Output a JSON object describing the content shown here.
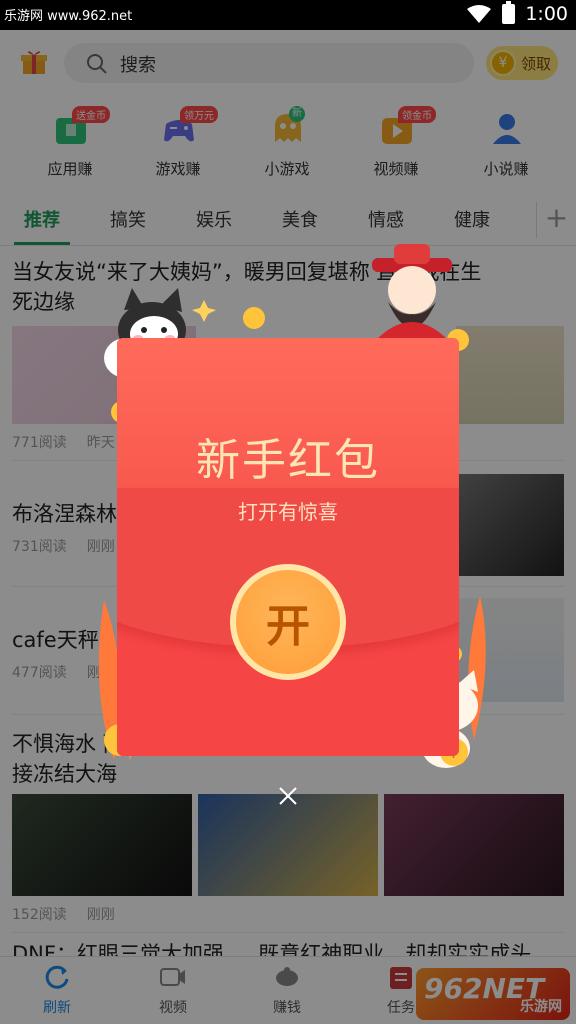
{
  "status_bar": {
    "watermark": "乐游网 www.962.net",
    "time": "1:00"
  },
  "header": {
    "search_placeholder": "搜索",
    "claim_label": "领取",
    "coin_symbol": "¥"
  },
  "quick": [
    {
      "label": "应用赚",
      "badge": "送金币",
      "icon": "app-earn-icon",
      "color": "#2cc37a"
    },
    {
      "label": "游戏赚",
      "badge": "领万元",
      "icon": "gamepad-icon",
      "color": "#6a6ef0"
    },
    {
      "label": "小游戏",
      "badge": "新",
      "icon": "ghost-icon",
      "color": "#f4b83a"
    },
    {
      "label": "视频赚",
      "badge": "领金币",
      "icon": "video-play-icon",
      "color": "#f6a623"
    },
    {
      "label": "小说赚",
      "badge": "",
      "icon": "reader-icon",
      "color": "#3a7be8"
    }
  ],
  "tabs": [
    "推荐",
    "搞笑",
    "娱乐",
    "美食",
    "情感",
    "健康"
  ],
  "tab_add": "+",
  "feed": [
    {
      "title": "当女友说“来了大姨妈”，暖男回复堪称 直男我在生",
      "title2": "死边缘",
      "reads": "771阅读",
      "time": "昨天"
    },
    {
      "title": "布洛涅森林",
      "reads": "731阅读",
      "time": "刚刚"
    },
    {
      "title": "cafe天秤",
      "reads": "477阅读",
      "time": "刚刚"
    },
    {
      "title": "不惧海水 而他能直",
      "title2": "接冻结大海",
      "reads": "152阅读",
      "time": "刚刚"
    },
    {
      "title": "DNF：红眼三觉大加强 … 既意红神职业，却却实实成头"
    }
  ],
  "nav": [
    {
      "label": "刷新",
      "icon": "refresh-icon"
    },
    {
      "label": "视频",
      "icon": "video-icon"
    },
    {
      "label": "赚钱",
      "icon": "piggy-icon"
    },
    {
      "label": "任务",
      "icon": "task-icon"
    }
  ],
  "logo": {
    "text": "962NET",
    "sub": "乐游网"
  },
  "popup": {
    "title": "新手红包",
    "subtitle": "打开有惊喜",
    "open_label": "开"
  },
  "colors": {
    "accent": "#1e9e5a",
    "packet": "#f64545",
    "nav_active": "#1e88e5"
  }
}
